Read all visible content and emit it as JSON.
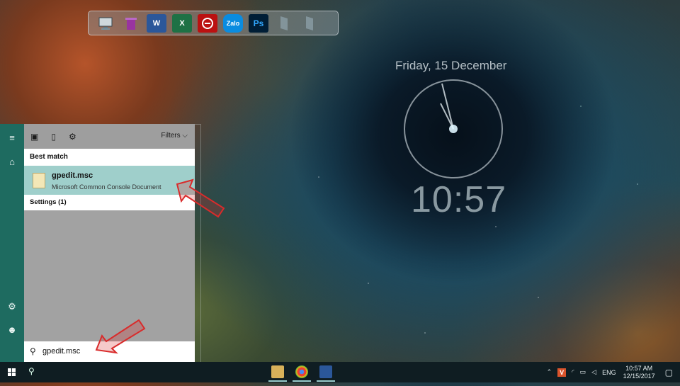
{
  "desktop": {
    "date": "Friday, 15 December",
    "time": "10:57"
  },
  "dock": {
    "items": [
      {
        "icon": "computer-icon",
        "label": ""
      },
      {
        "icon": "recycle-bin-icon",
        "label": ""
      },
      {
        "icon": "word-icon",
        "label": "W"
      },
      {
        "icon": "excel-icon",
        "label": "X"
      },
      {
        "icon": "garena-icon",
        "label": ""
      },
      {
        "icon": "zalo-icon",
        "label": "Zalo"
      },
      {
        "icon": "photoshop-icon",
        "label": "Ps"
      },
      {
        "icon": "placeholder-icon",
        "label": ""
      },
      {
        "icon": "placeholder-icon",
        "label": ""
      }
    ]
  },
  "start_menu": {
    "filters_label": "Filters",
    "best_match_label": "Best match",
    "result": {
      "title": "gpedit.msc",
      "subtitle": "Microsoft Common Console Document"
    },
    "settings_label": "Settings (1)",
    "search": {
      "value": "gpedit.msc"
    }
  },
  "taskbar": {
    "tray": {
      "language": "ENG",
      "time": "10:57 AM",
      "date": "12/15/2017"
    }
  },
  "colors": {
    "start_rail": "#1e6b60",
    "panel": "#a2a2a2",
    "highlight": "#9fcfcb",
    "taskbar": "#0f1d22",
    "arrow": "#d92b2b"
  }
}
